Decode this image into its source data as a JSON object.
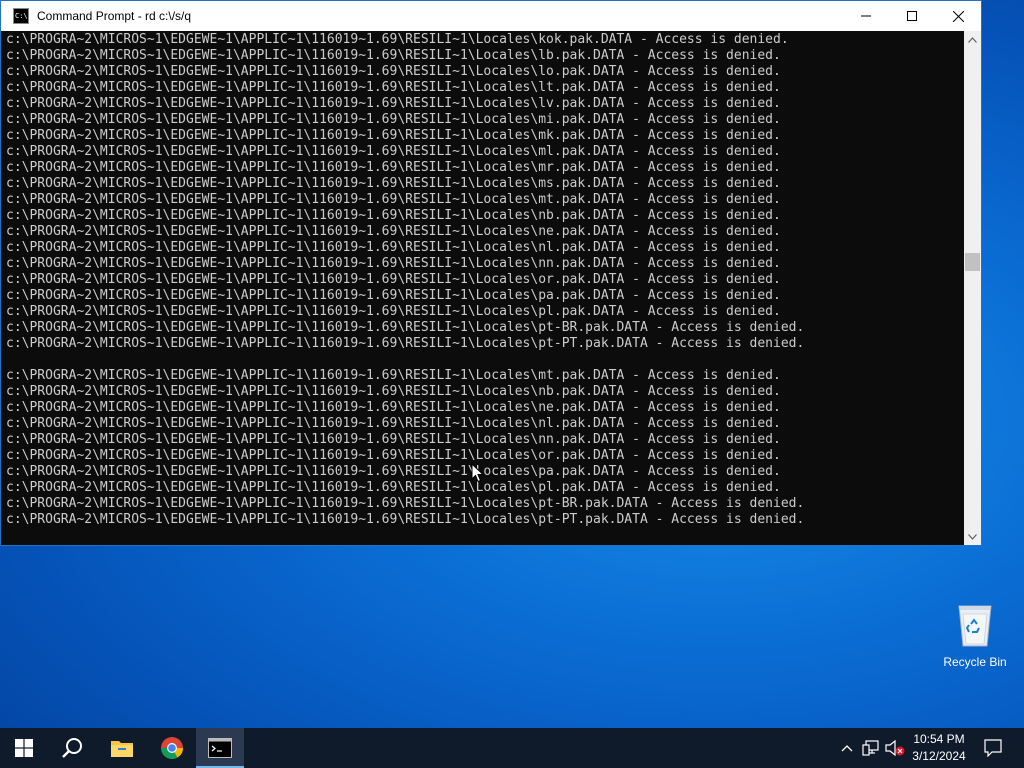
{
  "window": {
    "title": "Command Prompt - rd  c:\\/s/q",
    "app_icon_glyph": "C:\\",
    "minimize_icon": "minimize-icon",
    "maximize_icon": "maximize-icon",
    "close_icon": "close-icon"
  },
  "console": {
    "lines": [
      "c:\\PROGRA~2\\MICROS~1\\EDGEWE~1\\APPLIC~1\\116019~1.69\\RESILI~1\\Locales\\kok.pak.DATA - Access is denied.",
      "c:\\PROGRA~2\\MICROS~1\\EDGEWE~1\\APPLIC~1\\116019~1.69\\RESILI~1\\Locales\\lb.pak.DATA - Access is denied.",
      "c:\\PROGRA~2\\MICROS~1\\EDGEWE~1\\APPLIC~1\\116019~1.69\\RESILI~1\\Locales\\lo.pak.DATA - Access is denied.",
      "c:\\PROGRA~2\\MICROS~1\\EDGEWE~1\\APPLIC~1\\116019~1.69\\RESILI~1\\Locales\\lt.pak.DATA - Access is denied.",
      "c:\\PROGRA~2\\MICROS~1\\EDGEWE~1\\APPLIC~1\\116019~1.69\\RESILI~1\\Locales\\lv.pak.DATA - Access is denied.",
      "c:\\PROGRA~2\\MICROS~1\\EDGEWE~1\\APPLIC~1\\116019~1.69\\RESILI~1\\Locales\\mi.pak.DATA - Access is denied.",
      "c:\\PROGRA~2\\MICROS~1\\EDGEWE~1\\APPLIC~1\\116019~1.69\\RESILI~1\\Locales\\mk.pak.DATA - Access is denied.",
      "c:\\PROGRA~2\\MICROS~1\\EDGEWE~1\\APPLIC~1\\116019~1.69\\RESILI~1\\Locales\\ml.pak.DATA - Access is denied.",
      "c:\\PROGRA~2\\MICROS~1\\EDGEWE~1\\APPLIC~1\\116019~1.69\\RESILI~1\\Locales\\mr.pak.DATA - Access is denied.",
      "c:\\PROGRA~2\\MICROS~1\\EDGEWE~1\\APPLIC~1\\116019~1.69\\RESILI~1\\Locales\\ms.pak.DATA - Access is denied.",
      "c:\\PROGRA~2\\MICROS~1\\EDGEWE~1\\APPLIC~1\\116019~1.69\\RESILI~1\\Locales\\mt.pak.DATA - Access is denied.",
      "c:\\PROGRA~2\\MICROS~1\\EDGEWE~1\\APPLIC~1\\116019~1.69\\RESILI~1\\Locales\\nb.pak.DATA - Access is denied.",
      "c:\\PROGRA~2\\MICROS~1\\EDGEWE~1\\APPLIC~1\\116019~1.69\\RESILI~1\\Locales\\ne.pak.DATA - Access is denied.",
      "c:\\PROGRA~2\\MICROS~1\\EDGEWE~1\\APPLIC~1\\116019~1.69\\RESILI~1\\Locales\\nl.pak.DATA - Access is denied.",
      "c:\\PROGRA~2\\MICROS~1\\EDGEWE~1\\APPLIC~1\\116019~1.69\\RESILI~1\\Locales\\nn.pak.DATA - Access is denied.",
      "c:\\PROGRA~2\\MICROS~1\\EDGEWE~1\\APPLIC~1\\116019~1.69\\RESILI~1\\Locales\\or.pak.DATA - Access is denied.",
      "c:\\PROGRA~2\\MICROS~1\\EDGEWE~1\\APPLIC~1\\116019~1.69\\RESILI~1\\Locales\\pa.pak.DATA - Access is denied.",
      "c:\\PROGRA~2\\MICROS~1\\EDGEWE~1\\APPLIC~1\\116019~1.69\\RESILI~1\\Locales\\pl.pak.DATA - Access is denied.",
      "c:\\PROGRA~2\\MICROS~1\\EDGEWE~1\\APPLIC~1\\116019~1.69\\RESILI~1\\Locales\\pt-BR.pak.DATA - Access is denied.",
      "c:\\PROGRA~2\\MICROS~1\\EDGEWE~1\\APPLIC~1\\116019~1.69\\RESILI~1\\Locales\\pt-PT.pak.DATA - Access is denied.",
      "",
      "c:\\PROGRA~2\\MICROS~1\\EDGEWE~1\\APPLIC~1\\116019~1.69\\RESILI~1\\Locales\\mt.pak.DATA - Access is denied.",
      "c:\\PROGRA~2\\MICROS~1\\EDGEWE~1\\APPLIC~1\\116019~1.69\\RESILI~1\\Locales\\nb.pak.DATA - Access is denied.",
      "c:\\PROGRA~2\\MICROS~1\\EDGEWE~1\\APPLIC~1\\116019~1.69\\RESILI~1\\Locales\\ne.pak.DATA - Access is denied.",
      "c:\\PROGRA~2\\MICROS~1\\EDGEWE~1\\APPLIC~1\\116019~1.69\\RESILI~1\\Locales\\nl.pak.DATA - Access is denied.",
      "c:\\PROGRA~2\\MICROS~1\\EDGEWE~1\\APPLIC~1\\116019~1.69\\RESILI~1\\Locales\\nn.pak.DATA - Access is denied.",
      "c:\\PROGRA~2\\MICROS~1\\EDGEWE~1\\APPLIC~1\\116019~1.69\\RESILI~1\\Locales\\or.pak.DATA - Access is denied.",
      "c:\\PROGRA~2\\MICROS~1\\EDGEWE~1\\APPLIC~1\\116019~1.69\\RESILI~1\\Locales\\pa.pak.DATA - Access is denied.",
      "c:\\PROGRA~2\\MICROS~1\\EDGEWE~1\\APPLIC~1\\116019~1.69\\RESILI~1\\Locales\\pl.pak.DATA - Access is denied.",
      "c:\\PROGRA~2\\MICROS~1\\EDGEWE~1\\APPLIC~1\\116019~1.69\\RESILI~1\\Locales\\pt-BR.pak.DATA - Access is denied.",
      "c:\\PROGRA~2\\MICROS~1\\EDGEWE~1\\APPLIC~1\\116019~1.69\\RESILI~1\\Locales\\pt-PT.pak.DATA - Access is denied."
    ]
  },
  "desktop": {
    "recycle_bin_label": "Recycle Bin"
  },
  "taskbar": {
    "start_icon": "windows-logo-icon",
    "search_icon": "search-icon",
    "pinned": [
      "file-explorer-icon",
      "chrome-icon",
      "command-prompt-icon"
    ],
    "active_app": "command-prompt-icon",
    "tray_icons": [
      "chevron-up-icon",
      "network-icon",
      "volume-muted-icon"
    ],
    "clock_time": "10:54 PM",
    "clock_date": "3/12/2024",
    "notification_icon": "notification-icon"
  },
  "colors": {
    "console_bg": "#0c0c0c",
    "console_text": "#cccccc",
    "titlebar_bg": "#ffffff",
    "taskbar_bg": "#0f1a2b",
    "desktop_blue": "#0b6fd6"
  }
}
